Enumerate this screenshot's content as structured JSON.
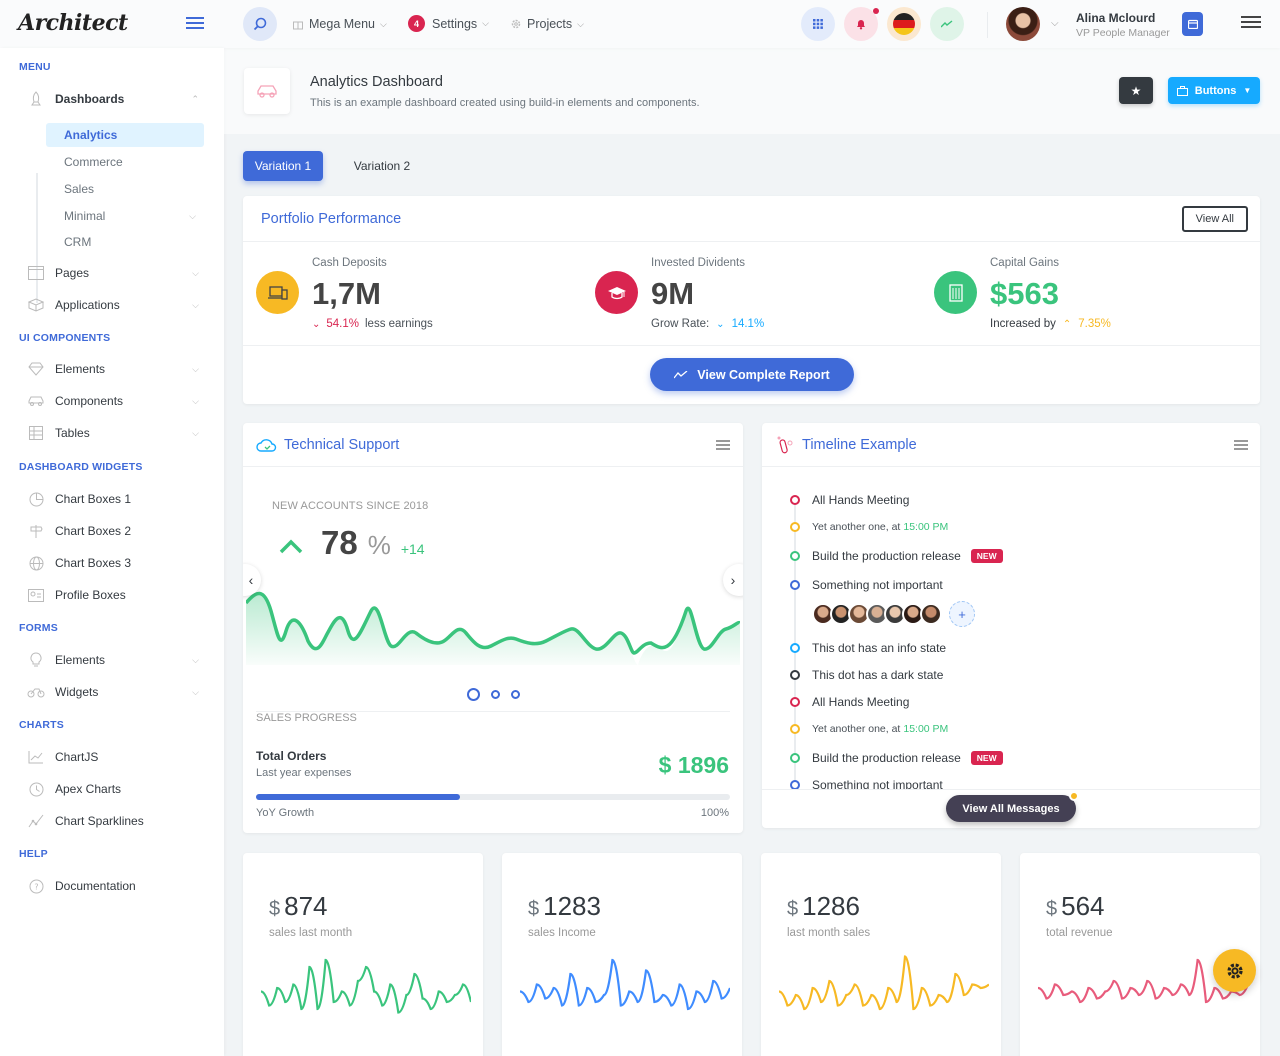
{
  "header": {
    "logo": "Architect",
    "mega_menu": "Mega Menu",
    "settings": "Settings",
    "settings_badge": "4",
    "projects": "Projects",
    "user_name": "Alina Mclourd",
    "user_role": "VP People Manager"
  },
  "sidebar": {
    "sections": {
      "menu": "MENU",
      "ui_components": "UI COMPONENTS",
      "dashboard_widgets": "DASHBOARD WIDGETS",
      "forms": "FORMS",
      "charts": "CHARTS",
      "help": "HELP"
    },
    "dashboards": "Dashboards",
    "dashboards_sub": [
      "Analytics",
      "Commerce",
      "Sales",
      "Minimal",
      "CRM"
    ],
    "pages": "Pages",
    "applications": "Applications",
    "ui": [
      "Elements",
      "Components",
      "Tables"
    ],
    "widgets": [
      "Chart Boxes 1",
      "Chart Boxes 2",
      "Chart Boxes 3",
      "Profile Boxes"
    ],
    "forms": [
      "Elements",
      "Widgets"
    ],
    "charts": [
      "ChartJS",
      "Apex Charts",
      "Chart Sparklines"
    ],
    "help": [
      "Documentation"
    ]
  },
  "page": {
    "title": "Analytics Dashboard",
    "subtitle": "This is an example dashboard created using build-in elements and components.",
    "buttons_label": "Buttons",
    "tabs": [
      "Variation 1",
      "Variation 2"
    ]
  },
  "portfolio": {
    "title": "Portfolio Performance",
    "view_all": "View All",
    "stats": [
      {
        "label": "Cash Deposits",
        "value": "1,7M",
        "delta": "54.1%",
        "note": "less earnings"
      },
      {
        "label": "Invested Dividents",
        "value": "9M",
        "prefix": "Grow Rate:",
        "delta": "14.1%"
      },
      {
        "label": "Capital Gains",
        "value": "$563",
        "prefix": "Increased by",
        "delta": "7.35%"
      }
    ],
    "report_button": "View Complete Report"
  },
  "tech_support": {
    "title": "Technical Support",
    "metric_label": "NEW ACCOUNTS SINCE 2018",
    "metric_value": "78",
    "metric_unit": "%",
    "metric_delta": "+14",
    "sales_progress": "SALES PROGRESS",
    "total_orders": "Total Orders",
    "last_year": "Last year expenses",
    "orders_value": "$ 1896",
    "yoy": "YoY Growth",
    "yoy_pct": "100%",
    "progress": 0.43
  },
  "timeline": {
    "title": "Timeline Example",
    "items": [
      {
        "text": "All Hands Meeting",
        "color": "#d92550"
      },
      {
        "text": "Yet another one, at ",
        "time": "15:00 PM",
        "color": "#f7b924"
      },
      {
        "text": "Build the production release",
        "badge": "NEW",
        "color": "#3ac47d"
      },
      {
        "text": "Something not important",
        "color": "#3f6ad8"
      },
      {
        "text": "This dot has an info state",
        "color": "#16aaff"
      },
      {
        "text": "This dot has a dark state",
        "color": "#343a40"
      },
      {
        "text": "All Hands Meeting",
        "color": "#d92550"
      },
      {
        "text": "Yet another one, at ",
        "time": "15:00 PM",
        "color": "#f7b924"
      },
      {
        "text": "Build the production release",
        "badge": "NEW",
        "color": "#3ac47d"
      },
      {
        "text": "Something not important",
        "color": "#3f6ad8"
      }
    ],
    "view_messages": "View All Messages"
  },
  "mini_cards": [
    {
      "currency": "$",
      "value": "874",
      "label": "sales last month",
      "color": "#3ac47d"
    },
    {
      "currency": "$",
      "value": "1283",
      "label": "sales Income",
      "color": "#3f8cff"
    },
    {
      "currency": "$",
      "value": "1286",
      "label": "last month sales",
      "color": "#f7b924"
    },
    {
      "currency": "$",
      "value": "564",
      "label": "total revenue",
      "color": "#e85c7c"
    }
  ]
}
